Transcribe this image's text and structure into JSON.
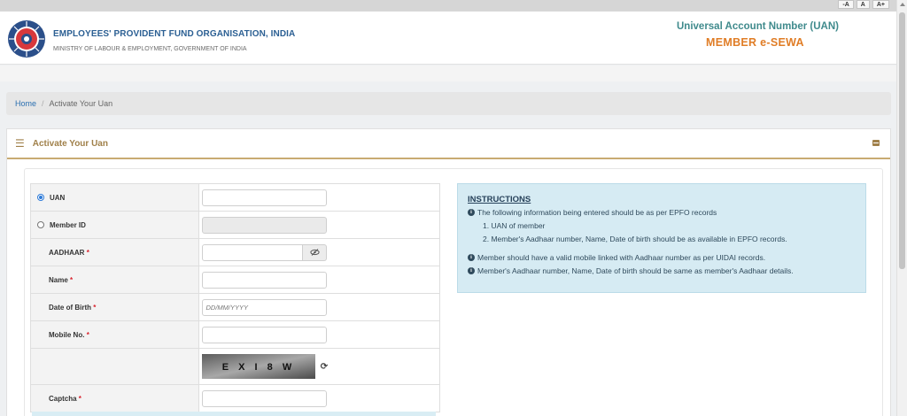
{
  "font_controls": [
    "-A",
    "A",
    "A+"
  ],
  "header": {
    "org_name": "EMPLOYEES' PROVIDENT FUND ORGANISATION, INDIA",
    "ministry": "MINISTRY OF LABOUR & EMPLOYMENT, GOVERNMENT OF INDIA",
    "uan_title": "Universal Account Number (UAN)",
    "portal_name": "MEMBER e-SEWA",
    "logo_icon": "epfo-emblem-icon"
  },
  "breadcrumb": {
    "home": "Home",
    "separator": "/",
    "current": "Activate Your Uan"
  },
  "panel": {
    "title": "Activate Your Uan",
    "menu_icon": "hamburger-icon",
    "collapse_icon": "collapse-icon"
  },
  "form": {
    "uan_label": "UAN",
    "uan_selected": true,
    "member_id_label": "Member ID",
    "member_id_selected": false,
    "aadhaar_label": "AADHAAR",
    "aadhaar_value": "",
    "name_label": "Name",
    "name_value": "",
    "dob_label": "Date of Birth",
    "dob_placeholder": "DD/MM/YYYY",
    "mobile_label": "Mobile No.",
    "mobile_value": "",
    "captcha_text": "E X I 8 W",
    "captcha_label": "Captcha",
    "required_mark": "*"
  },
  "instructions": {
    "title": "INSTRUCTIONS",
    "intro": "The following information being entered should be as per EPFO records",
    "sub_items": [
      "1. UAN of member",
      "2. Member's Aadhaar number, Name, Date of birth should be as available in EPFO records."
    ],
    "notes": [
      "Member should have a valid mobile linked with Aadhaar number as per UIDAI records.",
      "Member's Aadhaar number, Name, Date of birth should be same as member's Aadhaar details."
    ]
  },
  "colors": {
    "brand_blue": "#2b5f93",
    "esewa_orange": "#e07d26",
    "uan_teal": "#3f8a8c",
    "panel_gold": "#a0804a",
    "instructions_bg": "#d6ebf3"
  }
}
